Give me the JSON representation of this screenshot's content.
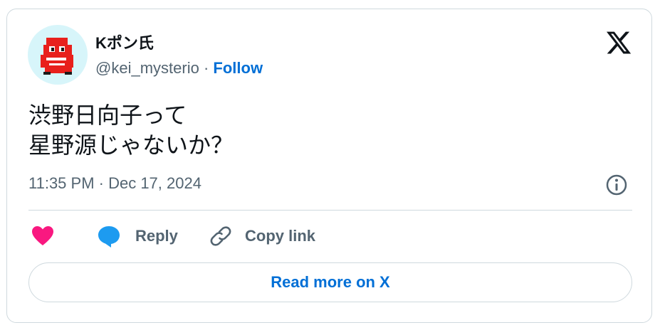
{
  "author": {
    "name": "Kポン氏",
    "handle": "@kei_mysterio",
    "separator": "·",
    "follow_label": "Follow"
  },
  "tweet": {
    "line1": "渋野日向子って",
    "line2": "星野源じゃないか？"
  },
  "timestamp": "11:35 PM · Dec 17, 2024",
  "actions": {
    "reply_label": "Reply",
    "copy_link_label": "Copy link"
  },
  "read_more_label": "Read more on X",
  "colors": {
    "accent": "#006fd6",
    "like": "#f91880",
    "reply": "#1d9bf0",
    "secondary_text": "#536471",
    "border": "#cfd9de",
    "avatar_bg": "#d7f5fa"
  },
  "icons": [
    "avatar",
    "x-logo-icon",
    "info-icon",
    "heart-icon",
    "reply-bubble-icon",
    "link-icon"
  ]
}
